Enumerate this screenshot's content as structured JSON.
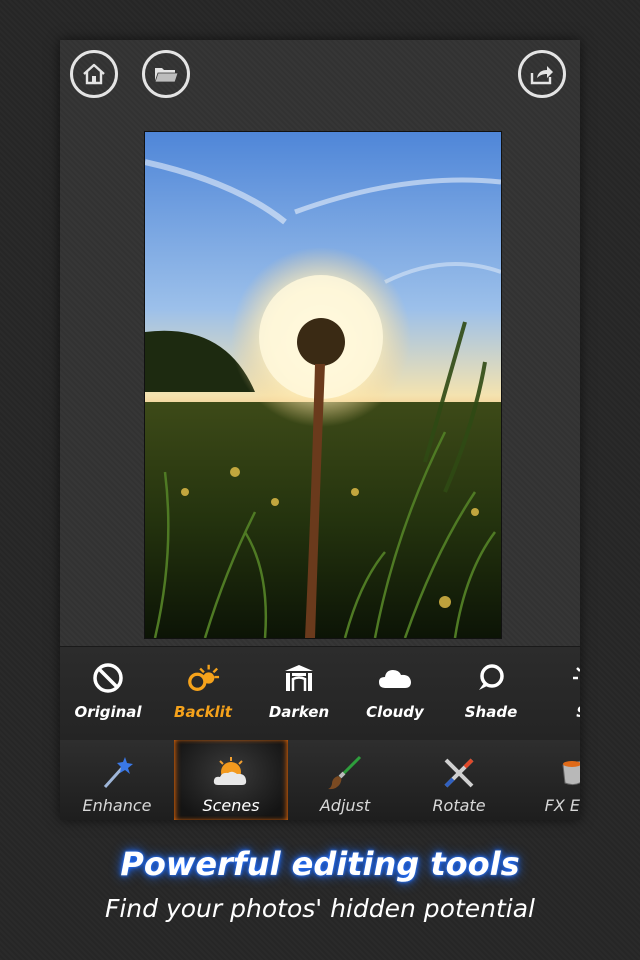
{
  "top_buttons": {
    "home": "home-icon",
    "folder": "folder-icon",
    "share": "share-icon"
  },
  "scenes": [
    {
      "label": "Original",
      "icon": "no-symbol-icon"
    },
    {
      "label": "Backlit",
      "icon": "backlit-sun-icon",
      "active": true
    },
    {
      "label": "Darken",
      "icon": "darken-house-icon"
    },
    {
      "label": "Cloudy",
      "icon": "cloud-icon"
    },
    {
      "label": "Shade",
      "icon": "shade-icon"
    },
    {
      "label": "Su",
      "icon": "sun-icon"
    }
  ],
  "tools": [
    {
      "label": "Enhance",
      "icon": "magic-wand-icon"
    },
    {
      "label": "Scenes",
      "icon": "scenes-sun-cloud-icon",
      "active": true
    },
    {
      "label": "Adjust",
      "icon": "paintbrush-icon"
    },
    {
      "label": "Rotate",
      "icon": "crossed-tools-icon"
    },
    {
      "label": "FX Effe",
      "icon": "paint-bucket-icon"
    }
  ],
  "promo": {
    "headline": "Powerful editing tools",
    "subline": "Find your photos' hidden potential"
  },
  "colors": {
    "active_scene": "#f5a21b",
    "headline_glow": "#1e6cff",
    "active_tool_glow": "#e66a0a"
  }
}
